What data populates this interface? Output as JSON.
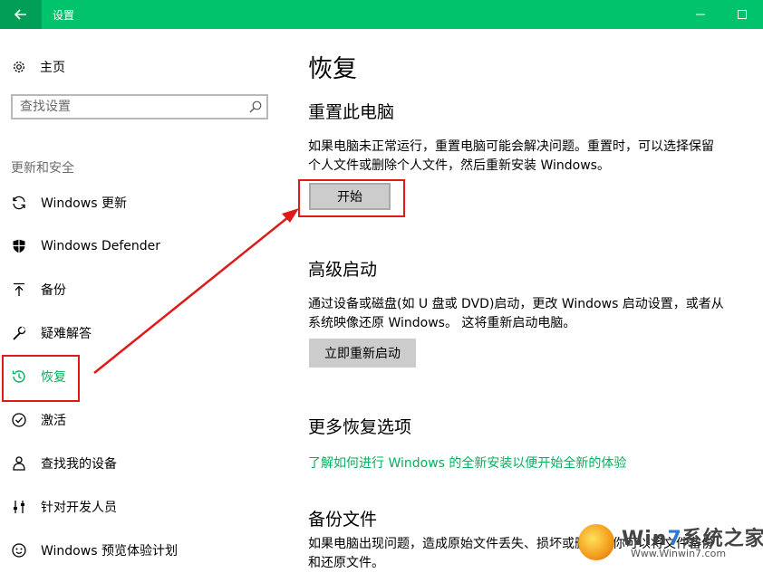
{
  "titlebar": {
    "title": "设置",
    "bg": "#00c36b"
  },
  "sidebar": {
    "home_label": "主页",
    "search_placeholder": "查找设置",
    "group_title": "更新和安全",
    "items": [
      {
        "label": "Windows 更新",
        "icon": "sync-icon"
      },
      {
        "label": "Windows Defender",
        "icon": "shield-icon"
      },
      {
        "label": "备份",
        "icon": "upload-arrow-icon"
      },
      {
        "label": "疑难解答",
        "icon": "wrench-icon"
      },
      {
        "label": "恢复",
        "icon": "history-icon",
        "active": true
      },
      {
        "label": "激活",
        "icon": "check-circle-icon"
      },
      {
        "label": "查找我的设备",
        "icon": "person-location-icon"
      },
      {
        "label": "针对开发人员",
        "icon": "developer-sliders-icon"
      },
      {
        "label": "Windows 预览体验计划",
        "icon": "insider-face-icon"
      }
    ]
  },
  "main": {
    "title": "恢复",
    "reset": {
      "title": "重置此电脑",
      "desc": "如果电脑未正常运行，重置电脑可能会解决问题。重置时，可以选择保留个人文件或删除个人文件，然后重新安装 Windows。",
      "button": "开始"
    },
    "advanced": {
      "title": "高级启动",
      "desc": "通过设备或磁盘(如 U 盘或 DVD)启动，更改 Windows 启动设置，或者从系统映像还原 Windows。 这将重新启动电脑。",
      "button": "立即重新启动"
    },
    "more": {
      "title": "更多恢复选项",
      "link": "了解如何进行 Windows 的全新安装以便开始全新的体验"
    },
    "backup": {
      "title": "备份文件",
      "desc": "如果电脑出现问题，造成原始文件丢失、损坏或删除，你可以将文件备份和还原文件。"
    }
  },
  "watermark": {
    "brand_prefix": "Win",
    "brand_seven": "7",
    "brand_suffix": "系统之家",
    "url": "Www.Winwin7.com"
  },
  "colors": {
    "accent": "#00b25c",
    "annotation": "#e01919"
  }
}
